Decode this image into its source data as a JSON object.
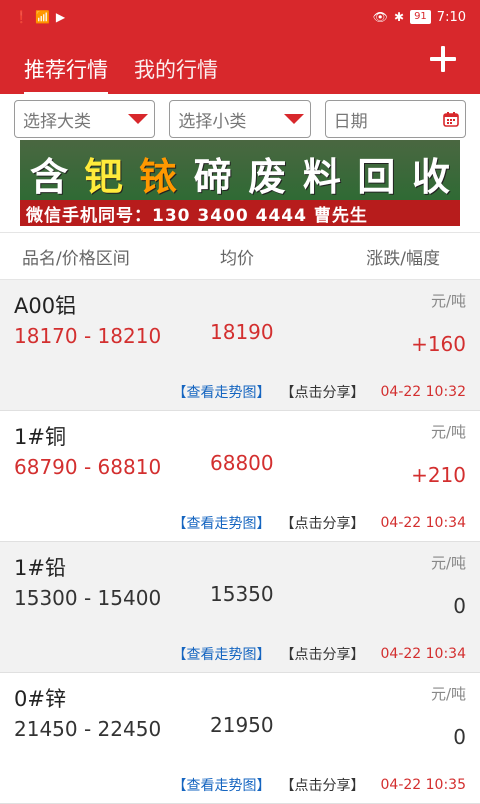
{
  "status_bar": {
    "time": "7:10",
    "battery": "91"
  },
  "header": {
    "tabs": [
      {
        "label": "推荐行情",
        "active": true
      },
      {
        "label": "我的行情",
        "active": false
      }
    ]
  },
  "filters": {
    "category": "选择大类",
    "subcategory": "选择小类",
    "date": "日期"
  },
  "banner": {
    "chars": [
      "含",
      "钯",
      "铱",
      "碲",
      "废",
      "料",
      "回",
      "收"
    ],
    "sub": "微信手机同号：130 3400 4444 曹先生"
  },
  "columns": {
    "name": "品名/价格区间",
    "avg": "均价",
    "change": "涨跌/幅度"
  },
  "items": [
    {
      "name": "A00铝",
      "unit": "元/吨",
      "range": "18170 - 18210",
      "avg": "18190",
      "change": "+160",
      "chart": "【查看走势图】",
      "share": "【点击分享】",
      "time": "04-22 10:32"
    },
    {
      "name": "1#铜",
      "unit": "元/吨",
      "range": "68790 - 68810",
      "avg": "68800",
      "change": "+210",
      "chart": "【查看走势图】",
      "share": "【点击分享】",
      "time": "04-22 10:34"
    },
    {
      "name": "1#铅",
      "unit": "元/吨",
      "range": "15300 - 15400",
      "avg": "15350",
      "change": "0",
      "chart": "【查看走势图】",
      "share": "【点击分享】",
      "time": "04-22 10:34"
    },
    {
      "name": "0#锌",
      "unit": "元/吨",
      "range": "21450 - 22450",
      "avg": "21950",
      "change": "0",
      "chart": "【查看走势图】",
      "share": "【点击分享】",
      "time": "04-22 10:35"
    }
  ],
  "colors": {
    "accent": "#d8282c",
    "up": "#d32f2f",
    "link": "#1565c0"
  }
}
